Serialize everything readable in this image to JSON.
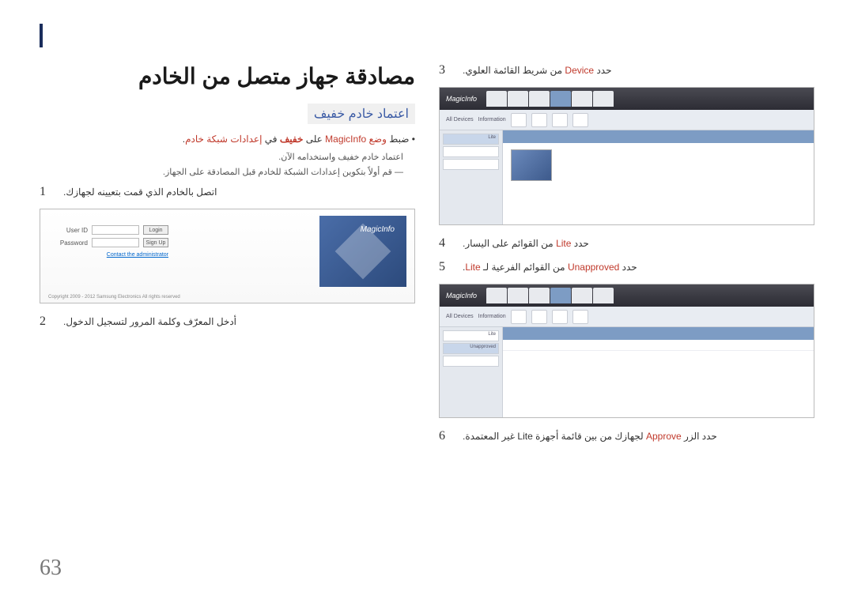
{
  "page_number": "63",
  "main_title": "مصادقة جهاز متصل من الخادم",
  "sub_title": "اعتماد خادم خفيف",
  "config_line_prefix": "• ضبط ",
  "config_mode": "وضع MagicInfo",
  "config_mid": " على ",
  "config_light": "خفيف",
  "config_in": " في ",
  "config_net": "إعدادات شبكة خادم",
  "config_end": ".",
  "approve_line_pre": "اعتماد خادم ",
  "approve_light": "خفيف",
  "approve_line_post": " واستخدامه الآن.",
  "dash_line_pre": "― قم أولاً بتكوين ",
  "dash_net": "إعدادات الشبكة",
  "dash_line_post": " للخادم قبل المصادقة على الجهاز.",
  "step1_num": "1",
  "step1_text": "اتصل بالخادم الذي قمت بتعيينه لجهازك.",
  "step2_num": "2",
  "step2_text": "أدخل المعرّف وكلمة المرور لتسجيل الدخول.",
  "step3_num": "3",
  "step3_pre": "حدد ",
  "step3_kw": "Device",
  "step3_post": " من شريط القائمة العلوي.",
  "step4_num": "4",
  "step4_pre": "حدد ",
  "step4_kw": "Lite",
  "step4_post": " من القوائم على اليسار.",
  "step5_num": "5",
  "step5_pre": "حدد ",
  "step5_kw": "Unapproved",
  "step5_post": " من القوائم الفرعية لـ ",
  "step5_kw2": "Lite",
  "step5_end": ".",
  "step6_num": "6",
  "step6_pre": "حدد الزر ",
  "step6_kw": "Approve",
  "step6_post": " لجهازك من بين قائمة أجهزة Lite غير المعتمدة.",
  "login_logo": "MagicInfo",
  "login_userid_label": "User ID",
  "login_password_label": "Password",
  "login_btn": "Login",
  "signup_btn": "Sign Up",
  "login_admin_link": "Contact the administrator",
  "login_copyright": "Copyright 2009 - 2012 Samsung Electronics All rights reserved",
  "app_logo": "MagicInfo",
  "toolbar_label1": "All Devices",
  "toolbar_label2": "Information",
  "side_lite": "Lite",
  "side_unapproved": "Unapproved"
}
